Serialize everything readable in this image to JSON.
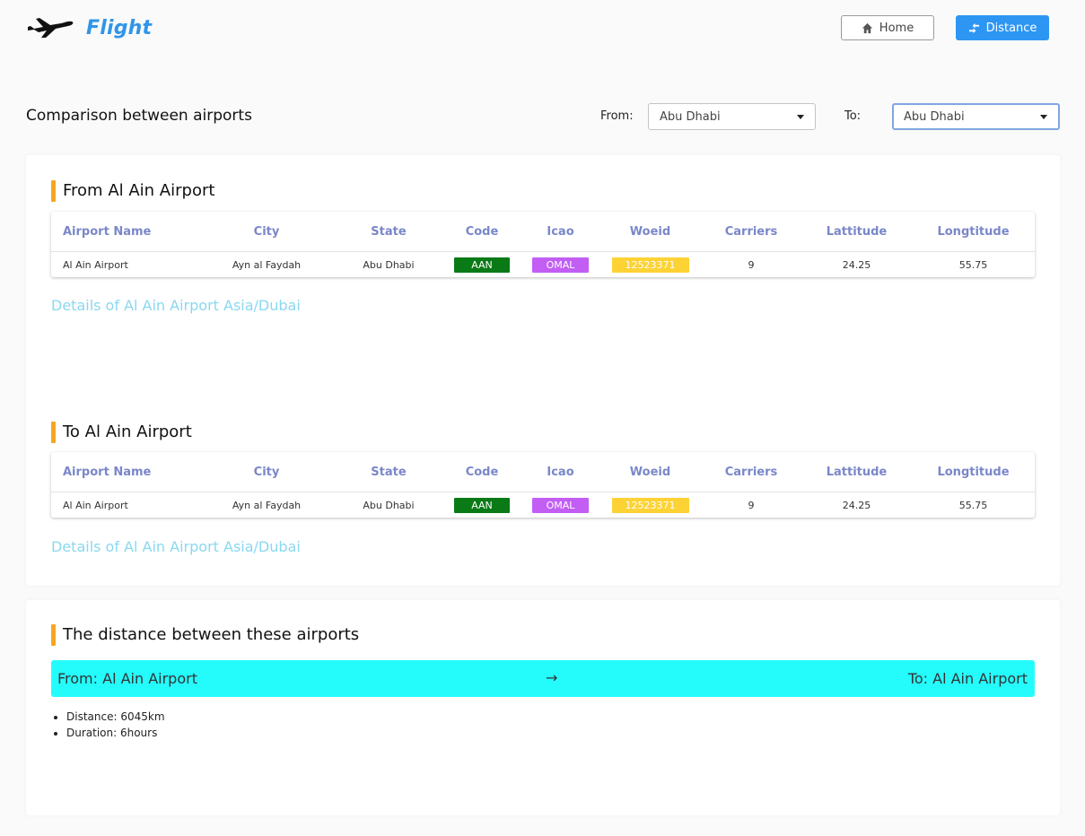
{
  "brand": {
    "name": "Flight"
  },
  "nav": {
    "home_label": "Home",
    "distance_label": "Distance"
  },
  "comparison": {
    "title": "Comparison between airports",
    "from_label": "From:",
    "to_label": "To:",
    "from_value": "Abu Dhabi",
    "to_value": "Abu Dhabi"
  },
  "table_headers": [
    "Airport Name",
    "City",
    "State",
    "Code",
    "Icao",
    "Woeid",
    "Carriers",
    "Lattitude",
    "Longtitude"
  ],
  "from_section": {
    "title": "From Al Ain Airport",
    "row": {
      "name": "Al Ain Airport",
      "city": "Ayn al Faydah",
      "state": "Abu Dhabi",
      "code": "AAN",
      "icao": "OMAL",
      "woeid": "12523371",
      "carriers": "9",
      "lat": "24.25",
      "lng": "55.75"
    },
    "details_link": "Details of Al Ain Airport Asia/Dubai"
  },
  "to_section": {
    "title": "To Al Ain Airport",
    "row": {
      "name": "Al Ain Airport",
      "city": "Ayn al Faydah",
      "state": "Abu Dhabi",
      "code": "AAN",
      "icao": "OMAL",
      "woeid": "12523371",
      "carriers": "9",
      "lat": "24.25",
      "lng": "55.75"
    },
    "details_link": "Details of Al Ain Airport Asia/Dubai"
  },
  "distance_section": {
    "title": "The distance between these airports",
    "from_text": "From: Al Ain Airport",
    "arrow": "→",
    "to_text": "To: Al Ain Airport",
    "distance": "Distance: 6045km",
    "duration": "Duration: 6hours"
  },
  "colors": {
    "accent": "#2d96f3",
    "section_bar": "#f5a623",
    "code_badge": "#0a7a17",
    "icao_badge": "#c25ef4",
    "woeid_badge": "#fdd235",
    "route_bg": "#24fcfc",
    "header_text": "#7a87c9",
    "details_link": "#8ad8f0"
  },
  "icons": {
    "logo": "airplane-icon",
    "home": "home-icon",
    "distance": "distance-icon",
    "dropdown": "caret-down-icon"
  }
}
